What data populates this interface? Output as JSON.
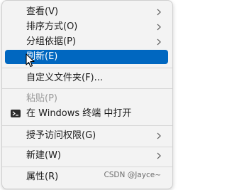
{
  "menu": {
    "items": [
      {
        "label": "查看(V)"
      },
      {
        "label": "排序方式(O)"
      },
      {
        "label": "分组依据(P)"
      },
      {
        "label": "刷新(E)"
      },
      {
        "label": "自定义文件夹(F)..."
      },
      {
        "label": "粘贴(P)"
      },
      {
        "label": "在 Windows 终端 中打开"
      },
      {
        "label": "授予访问权限(G)"
      },
      {
        "label": "新建(W)"
      },
      {
        "label": "属性(R)"
      }
    ]
  },
  "watermark": "CSDN @Jayce~",
  "colors": {
    "selection": "#0067c0",
    "menu_background": "#f3f3f3"
  },
  "icons": {
    "submenu": "chevron-right-icon",
    "terminal": "terminal-icon",
    "cursor": "mouse-pointer-icon"
  }
}
